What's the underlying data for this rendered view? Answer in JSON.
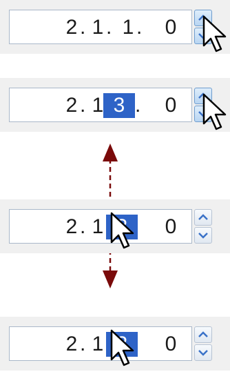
{
  "panels": [
    {
      "segments": [
        "2",
        "1",
        "1",
        "0"
      ],
      "selected_index": null,
      "spin_hot": true
    },
    {
      "segments": [
        "2",
        "1",
        "3",
        "0"
      ],
      "selected_index": 2,
      "spin_hot": true
    },
    {
      "segments": [
        "2",
        "1",
        "3",
        "0"
      ],
      "selected_index": 2,
      "spin_hot": false
    },
    {
      "segments": [
        "2",
        "1",
        "3",
        "0"
      ],
      "selected_index": 2,
      "spin_hot": false
    }
  ],
  "icons": {
    "cursor": "mouse-pointer-icon",
    "spin_up": "chevron-up-icon",
    "spin_down": "chevron-down-icon",
    "drag": "double-headed-vertical-arrow"
  },
  "colors": {
    "selection": "#2e63c7",
    "drag_arrow": "#7a0a0a",
    "spin_button": "#3a72c8"
  }
}
